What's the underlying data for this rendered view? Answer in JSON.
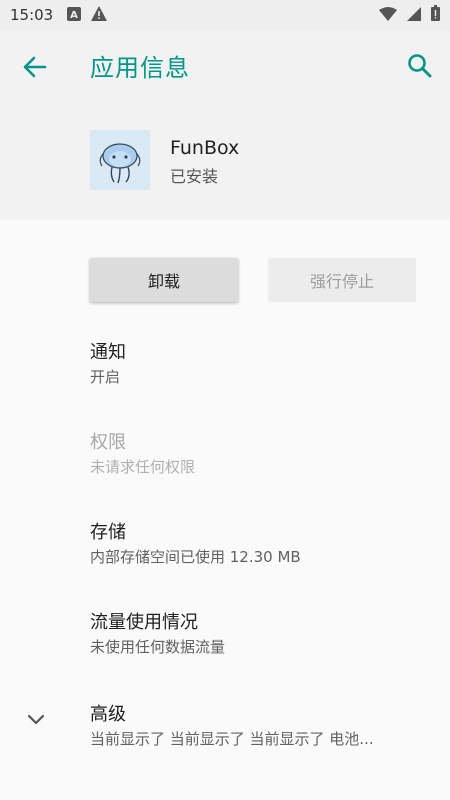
{
  "status_bar": {
    "time": "15:03",
    "left_icons": [
      "a-notification-icon",
      "warning-icon"
    ],
    "right_icons": [
      "wifi-icon",
      "signal-icon",
      "battery-icon"
    ]
  },
  "app_bar": {
    "title": "应用信息"
  },
  "app": {
    "name": "FunBox",
    "status": "已安装"
  },
  "buttons": {
    "uninstall": "卸载",
    "force_stop": "强行停止"
  },
  "prefs": [
    {
      "title": "通知",
      "summary": "开启"
    },
    {
      "title": "权限",
      "summary": "未请求任何权限"
    },
    {
      "title": "存储",
      "summary": "内部存储空间已使用 12.30 MB"
    },
    {
      "title": "流量使用情况",
      "summary": "未使用任何数据流量"
    },
    {
      "title": "高级",
      "summary": "当前显示了 当前显示了 当前显示了 电池..."
    }
  ],
  "colors": {
    "accent": "#009688",
    "app_bar_bg": "#f2f2f2",
    "body_bg": "#fafafa"
  }
}
